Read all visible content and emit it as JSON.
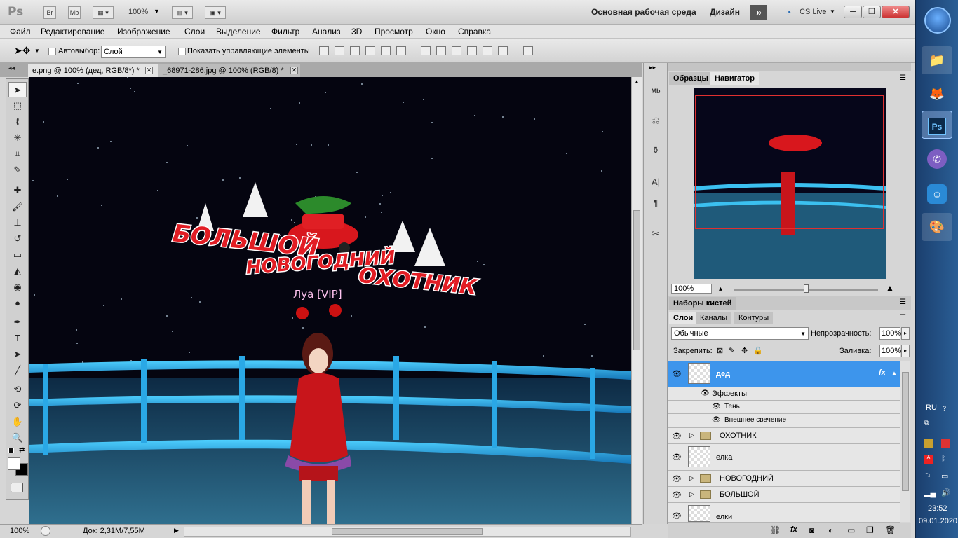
{
  "app": {
    "logo": "Ps",
    "br_btn": "Br",
    "mb_btn": "Mb",
    "zoom_top": "100%",
    "workspace": "Основная рабочая среда",
    "design": "Дизайн",
    "expand": "»",
    "cs_live": "CS Live"
  },
  "menu": [
    "Файл",
    "Редактирование",
    "Изображение",
    "Слои",
    "Выделение",
    "Фильтр",
    "Анализ",
    "3D",
    "Просмотр",
    "Окно",
    "Справка"
  ],
  "options": {
    "autoselect_label": "Автовыбор:",
    "autoselect_value": "Слой",
    "show_controls": "Показать управляющие элементы"
  },
  "doc_tabs": [
    {
      "label": "e.png @ 100% (дед, RGB/8*) *",
      "active": true
    },
    {
      "label": "_68971-286.jpg @ 100% (RGB/8) *",
      "active": false
    }
  ],
  "canvas": {
    "logo_line1": "БОЛЬШОЙ",
    "logo_line2": "НОВОГОДНИЙ",
    "logo_line3": "ОХОТНИК",
    "nameplate": "Луа [VIP]"
  },
  "status": {
    "zoom": "100%",
    "doc": "Док: 2,31М/7,55М"
  },
  "navigator": {
    "tabs": [
      "Образцы",
      "Навигатор"
    ],
    "active": "Навигатор",
    "zoom": "100%"
  },
  "brushes": {
    "title": "Наборы кистей"
  },
  "layers_panel": {
    "tabs": [
      "Слои",
      "Каналы",
      "Контуры"
    ],
    "active": "Слои",
    "blend": "Обычные",
    "opacity_label": "Непрозрачность:",
    "opacity": "100%",
    "lock_label": "Закрепить:",
    "fill_label": "Заливка:",
    "fill": "100%"
  },
  "layers": [
    {
      "name": "дед",
      "type": "layer",
      "selected": true,
      "fx": "fx"
    },
    {
      "name": "Эффекты",
      "type": "effects-header"
    },
    {
      "name": "Тень",
      "type": "effect"
    },
    {
      "name": "Внешнее свечение",
      "type": "effect"
    },
    {
      "name": "ОХОТНИК",
      "type": "group"
    },
    {
      "name": "елка",
      "type": "layer"
    },
    {
      "name": "НОВОГОДНИЙ",
      "type": "group"
    },
    {
      "name": "БОЛЬШОЙ",
      "type": "group"
    },
    {
      "name": "елки",
      "type": "layer"
    }
  ],
  "taskbar": {
    "lang": "RU",
    "time": "23:52",
    "date": "09.01.2020",
    "apps": [
      "windows-start",
      "explorer",
      "firefox",
      "photoshop",
      "viber",
      "game-app",
      "paint"
    ]
  },
  "colors": {
    "selected_layer": "#3d95ec",
    "accent_blue": "#2a5e95",
    "canvas_bg": "#050510"
  }
}
